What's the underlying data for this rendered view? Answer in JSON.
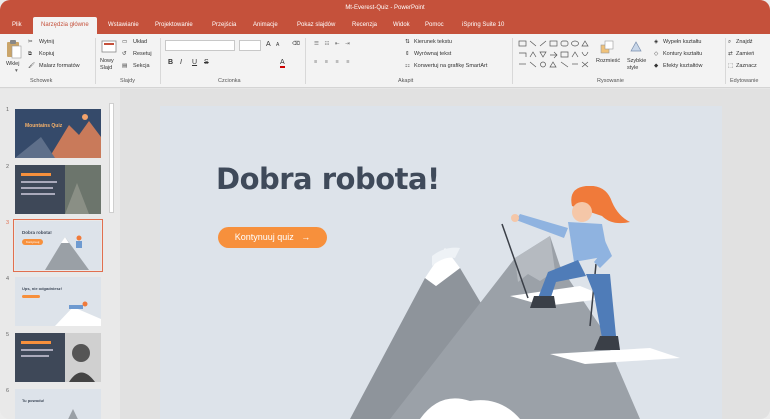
{
  "window": {
    "title": "Mt-Everest-Quiz - PowerPoint"
  },
  "tabs": [
    {
      "label": "Plik"
    },
    {
      "label": "Narzędzia główne"
    },
    {
      "label": "Wstawianie"
    },
    {
      "label": "Projektowanie"
    },
    {
      "label": "Przejścia"
    },
    {
      "label": "Animacje"
    },
    {
      "label": "Pokaz slajdów"
    },
    {
      "label": "Recenzja"
    },
    {
      "label": "Widok"
    },
    {
      "label": "Pomoc"
    },
    {
      "label": "iSpring Suite 10"
    }
  ],
  "ribbon": {
    "clipboard": {
      "paste": "Wklej",
      "cut": "Wytnij",
      "copy": "Kopiuj",
      "format_painter": "Malarz formatów",
      "group": "Schowek"
    },
    "slides": {
      "new_slide_1": "Nowy",
      "new_slide_2": "Slajd",
      "layout": "Układ",
      "reset": "Resetuj",
      "section": "Sekcja",
      "group": "Slajdy"
    },
    "font": {
      "group": "Czcionka",
      "bold": "B",
      "italic": "I",
      "underline": "U",
      "strike": "S",
      "grow": "A",
      "shrink": "A",
      "color": "A"
    },
    "paragraph": {
      "text_direction": "Kierunek tekstu",
      "align_text": "Wyrównaj tekst",
      "convert_smartart": "Konwertuj na grafikę SmartArt",
      "group": "Akapit"
    },
    "drawing": {
      "arrange": "Rozmieść",
      "quick_styles_1": "Szybkie",
      "quick_styles_2": "style",
      "shape_fill": "Wypełn kształtu",
      "shape_outline": "Kontury kształtu",
      "shape_effects": "Efekty kształtów",
      "group": "Rysowanie"
    },
    "editing": {
      "find": "Znajdź",
      "replace": "Zamień",
      "select": "Zaznacz",
      "group": "Edytowanie"
    }
  },
  "thumbnails": [
    {
      "num": "1",
      "title": "Mountains Quiz"
    },
    {
      "num": "2",
      "title": ""
    },
    {
      "num": "3",
      "title": "Dobra robota!",
      "button": "Kontynuuj"
    },
    {
      "num": "4",
      "title": "Ups, nie odgadniesz!"
    },
    {
      "num": "5",
      "title": ""
    },
    {
      "num": "6",
      "title": "Tu powodu!"
    }
  ],
  "slide": {
    "heading": "Dobra robota!",
    "button_label": "Kontynuuj quiz",
    "button_arrow": "→"
  },
  "colors": {
    "accent": "#c5513b",
    "button": "#f7903c",
    "heading": "#3f4a5a",
    "slide_bg": "#dde3ea"
  }
}
